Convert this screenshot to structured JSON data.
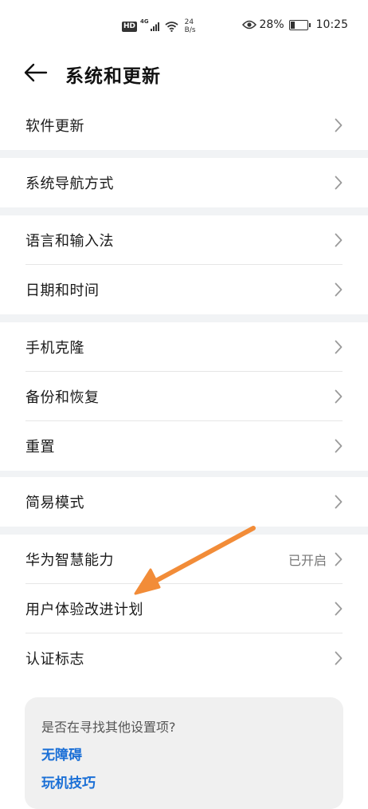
{
  "status_bar": {
    "hd": "HD",
    "network": "4G",
    "speed_value": "24",
    "speed_unit": "B/s",
    "battery": "28%",
    "battery_level": 0.28,
    "time": "10:25"
  },
  "header": {
    "title": "系统和更新",
    "back_icon": "arrow-left"
  },
  "groups": [
    {
      "items": [
        {
          "label": "软件更新"
        }
      ]
    },
    {
      "items": [
        {
          "label": "系统导航方式"
        }
      ]
    },
    {
      "items": [
        {
          "label": "语言和输入法"
        },
        {
          "label": "日期和时间"
        }
      ]
    },
    {
      "items": [
        {
          "label": "手机克隆"
        },
        {
          "label": "备份和恢复"
        },
        {
          "label": "重置"
        }
      ]
    },
    {
      "items": [
        {
          "label": "简易模式"
        }
      ]
    },
    {
      "items": [
        {
          "label": "华为智慧能力",
          "value": "已开启"
        },
        {
          "label": "用户体验改进计划"
        },
        {
          "label": "认证标志"
        }
      ]
    }
  ],
  "suggestions": {
    "title": "是否在寻找其他设置项?",
    "links": [
      "无障碍",
      "玩机技巧"
    ]
  },
  "annotation": {
    "color": "#f28c38",
    "icon": "arrow-pointer"
  }
}
